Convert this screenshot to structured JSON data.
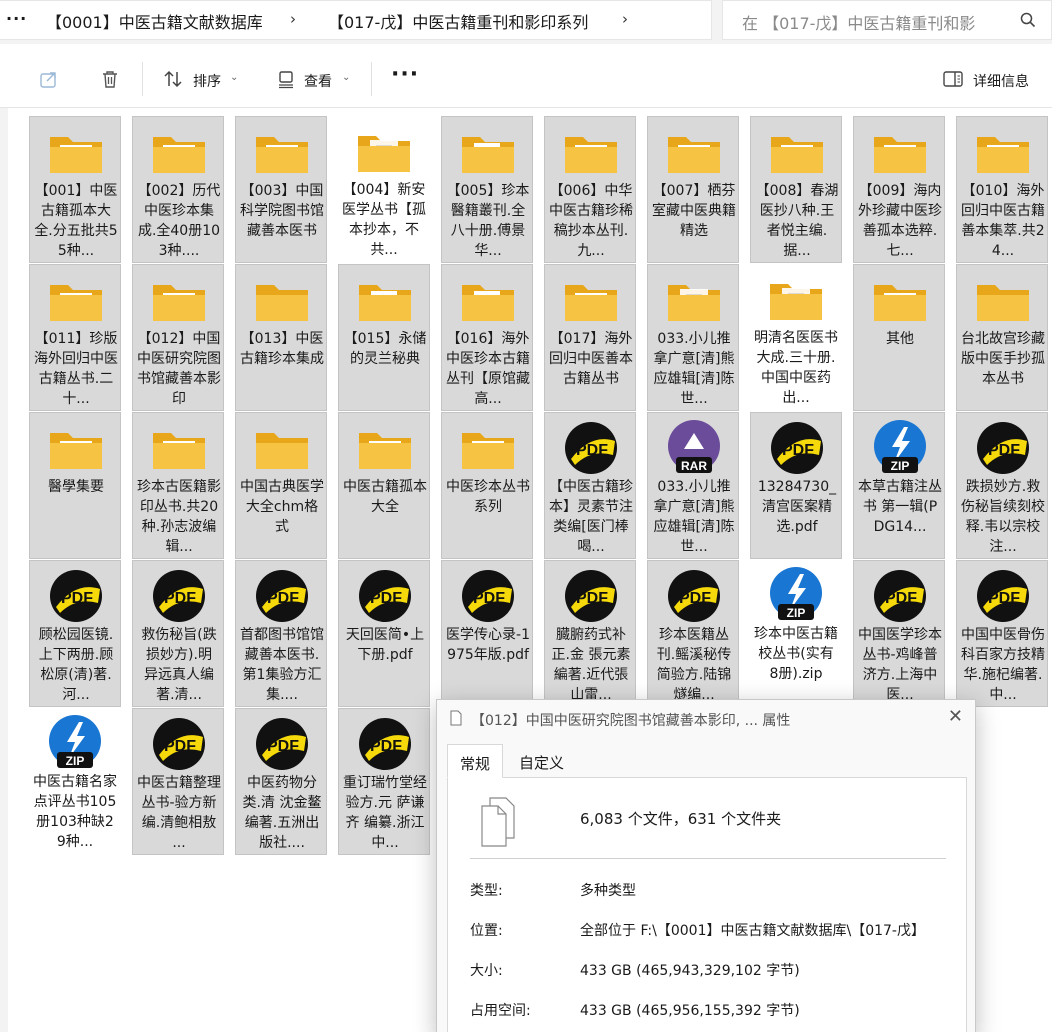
{
  "address_bar": {
    "crumbs": [
      "【0001】中医古籍文献数据库",
      "【017-戊】中医古籍重刊和影印系列"
    ],
    "search_placeholder": "在 【017-戊】中医古籍重刊和影"
  },
  "toolbar": {
    "sort_label": "排序",
    "view_label": "查看",
    "details_label": "详细信息"
  },
  "colors": {
    "selection_bg": "#d9d9d9",
    "folder_yellow": "#f6c343",
    "pdf_yellow": "#f5d90a",
    "zip_blue": "#1976d2",
    "rar_purple": "#6b4c9a"
  },
  "files": [
    {
      "name": "【001】中医古籍孤本大全.分五批共55种...",
      "icon": "folder-acrobat",
      "selected": true
    },
    {
      "name": "【002】历代中医珍本集成.全40册103种....",
      "icon": "folder-acrobat",
      "selected": true
    },
    {
      "name": "【003】中国科学院图书馆藏善本医书",
      "icon": "folder-acrobat",
      "selected": true
    },
    {
      "name": "【004】新安医学丛书【孤本抄本，不共...",
      "icon": "folder-docs",
      "selected": false
    },
    {
      "name": "【005】珍本醫籍叢刊.全八十册.傅景华...",
      "icon": "folder-excel",
      "selected": true
    },
    {
      "name": "【006】中华中医古籍珍稀稿抄本丛刊.九...",
      "icon": "folder-acrobat",
      "selected": true
    },
    {
      "name": "【007】栖芬室藏中医典籍精选",
      "icon": "folder-acrobat",
      "selected": true
    },
    {
      "name": "【008】春湖医抄八种.王者悦主编.据...",
      "icon": "folder-acrobat",
      "selected": true
    },
    {
      "name": "【009】海内外珍藏中医珍善孤本选粹.七...",
      "icon": "folder-acrobat",
      "selected": true
    },
    {
      "name": "【010】海外回归中医古籍善本集萃.共24...",
      "icon": "folder-acrobat",
      "selected": true
    },
    {
      "name": "【011】珍版海外回归中医古籍丛书.二十...",
      "icon": "folder-acrobat",
      "selected": true
    },
    {
      "name": "【012】中国中医研究院图书馆藏善本影印",
      "icon": "folder-acrobat",
      "selected": true
    },
    {
      "name": "【013】中医古籍珍本集成",
      "icon": "folder-plain",
      "selected": true
    },
    {
      "name": "【015】永储的灵兰秘典",
      "icon": "folder-word",
      "selected": true
    },
    {
      "name": "【016】海外中医珍本古籍丛刊【原馆藏高...",
      "icon": "folder-excel",
      "selected": true
    },
    {
      "name": "【017】海外回归中医善本古籍丛书",
      "icon": "folder-acrobat",
      "selected": true
    },
    {
      "name": "033.小儿推拿广意[清]熊应雄辑[清]陈世...",
      "icon": "folder-docs",
      "selected": true
    },
    {
      "name": "明清名医医书大成.三十册.中国中医药出...",
      "icon": "folder-docs",
      "selected": false
    },
    {
      "name": "其他",
      "icon": "folder-acrobat",
      "selected": true
    },
    {
      "name": "台北故宫珍藏版中医手抄孤本丛书",
      "icon": "folder-plain",
      "selected": true
    },
    {
      "name": "醫學集要",
      "icon": "folder-acrobat",
      "selected": true
    },
    {
      "name": "珍本古医籍影印丛书.共20种.孙志波编辑...",
      "icon": "folder-acrobat",
      "selected": true
    },
    {
      "name": "中国古典医学大全chm格式",
      "icon": "folder-plain",
      "selected": true
    },
    {
      "name": "中医古籍孤本大全",
      "icon": "folder-acrobat",
      "selected": true
    },
    {
      "name": "中医珍本丛书系列",
      "icon": "folder-acrobat",
      "selected": true
    },
    {
      "name": "【中医古籍珍本】灵素节注类编[医门棒喝...",
      "icon": "pdf",
      "selected": true
    },
    {
      "name": "033.小儿推拿广意[清]熊应雄辑[清]陈世...",
      "icon": "rar",
      "selected": true
    },
    {
      "name": "13284730_清宫医案精选.pdf",
      "icon": "pdf",
      "selected": true
    },
    {
      "name": "本草古籍注丛书 第一辑(PDG14...",
      "icon": "zip",
      "selected": true
    },
    {
      "name": "跌损妙方.救伤秘旨续刻校释.韦以宗校注...",
      "icon": "pdf",
      "selected": true
    },
    {
      "name": "顾松园医镜.上下两册.顾松原(清)著.河...",
      "icon": "pdf",
      "selected": true
    },
    {
      "name": "救伤秘旨(跌损妙方).明 异远真人编著.清...",
      "icon": "pdf",
      "selected": true
    },
    {
      "name": "首都图书馆馆藏善本医书.第1集验方汇集....",
      "icon": "pdf",
      "selected": true
    },
    {
      "name": "天回医简•上下册.pdf",
      "icon": "pdf",
      "selected": true
    },
    {
      "name": "医学传心录-1975年版.pdf",
      "icon": "pdf",
      "selected": true
    },
    {
      "name": "臓腑药式补正.金 張元素編著.近代張山雷...",
      "icon": "pdf",
      "selected": true
    },
    {
      "name": "珍本医籍丛刊.鳐溪秘传简验方.陆锦燧编...",
      "icon": "pdf",
      "selected": true
    },
    {
      "name": "珍本中医古籍校丛书(实有8册).zip",
      "icon": "zip",
      "selected": false
    },
    {
      "name": "中国医学珍本丛书-鸡峰普济方.上海中医...",
      "icon": "pdf",
      "selected": true
    },
    {
      "name": "中国中医骨伤科百家方技精华.施杞编著.中...",
      "icon": "pdf",
      "selected": true
    },
    {
      "name": "中医古籍名家点评丛书105册103种缺29种...",
      "icon": "zip",
      "selected": false
    },
    {
      "name": "中医古籍整理丛书-验方新编.清鲍相敖 ...",
      "icon": "pdf",
      "selected": true
    },
    {
      "name": "中医药物分类.清 沈金鳌编著.五洲出版社....",
      "icon": "pdf",
      "selected": true
    },
    {
      "name": "重订瑞竹堂经验方.元 萨谦齐 编纂.浙江中...",
      "icon": "pdf",
      "selected": true
    }
  ],
  "dialog": {
    "title": "【012】中国中医研究院图书馆藏善本影印, ... 属性",
    "tabs": [
      "常规",
      "自定义"
    ],
    "summary": "6,083 个文件，631 个文件夹",
    "rows": [
      {
        "label": "类型:",
        "value": "多种类型"
      },
      {
        "label": "位置:",
        "value": "全部位于 F:\\【0001】中医古籍文献数据库\\【017-戊】"
      },
      {
        "label": "大小:",
        "value": "433 GB (465,943,329,102 字节)"
      },
      {
        "label": "占用空间:",
        "value": "433 GB (465,956,155,392 字节)"
      }
    ]
  }
}
